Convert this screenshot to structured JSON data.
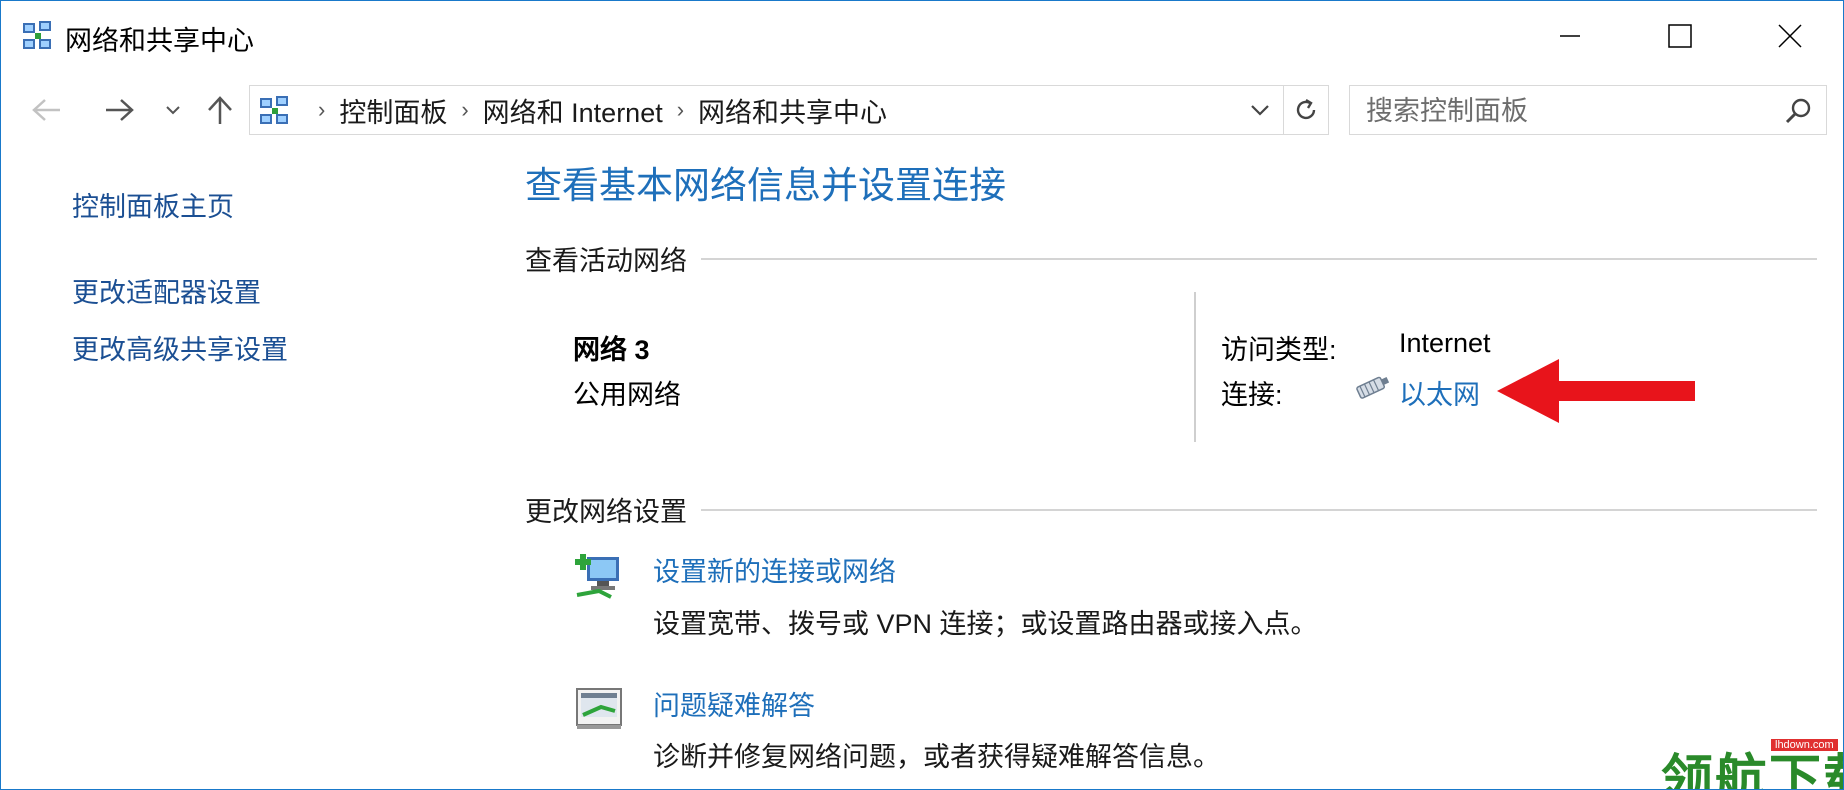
{
  "window": {
    "title": "网络和共享中心",
    "minimize_label": "最小化",
    "maximize_label": "最大化",
    "close_label": "关闭"
  },
  "navigation": {
    "breadcrumbs": [
      "控制面板",
      "网络和 Internet",
      "网络和共享中心"
    ],
    "search_placeholder": "搜索控制面板"
  },
  "sidebar": {
    "items": [
      {
        "label": "控制面板主页"
      },
      {
        "label": "更改适配器设置"
      },
      {
        "label": "更改高级共享设置"
      }
    ]
  },
  "main": {
    "title": "查看基本网络信息并设置连接",
    "active_networks_heading": "查看活动网络",
    "network": {
      "name": "网络  3",
      "category": "公用网络",
      "access_type_label": "访问类型:",
      "access_type_value": "Internet",
      "connection_label": "连接:",
      "connection_value": "以太网"
    },
    "change_settings_heading": "更改网络设置",
    "tasks": [
      {
        "title": "设置新的连接或网络",
        "description": "设置宽带、拨号或 VPN 连接；或设置路由器或接入点。"
      },
      {
        "title": "问题疑难解答",
        "description": "诊断并修复网络问题，或者获得疑难解答信息。"
      }
    ]
  },
  "watermark": {
    "text": "领航下载",
    "domain": "lhdown.com"
  },
  "colors": {
    "link": "#1e6fba",
    "sidebar_link": "#1b4f93",
    "arrow": "#e8141b",
    "border": "#1979ca"
  }
}
